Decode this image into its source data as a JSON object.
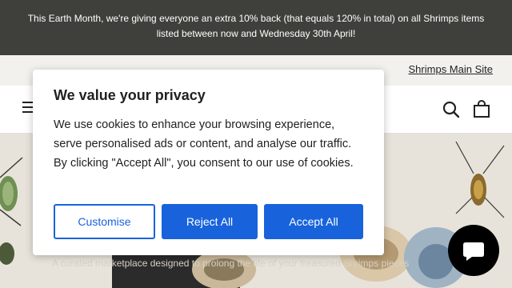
{
  "announcement": {
    "text": "This Earth Month, we're giving everyone an extra 10% back (that equals 120% in total) on all Shrimps items listed between now and Wednesday 30th April!"
  },
  "utility": {
    "main_site_link": "Shrimps Main Site"
  },
  "header": {
    "icons": [
      "menu-icon",
      "search-icon",
      "shopping-bag-icon"
    ]
  },
  "hero": {
    "tagline": "A curated marketplace designed to prolong the life of your treasured Shrimps pieces"
  },
  "cookie_banner": {
    "title": "We value your privacy",
    "body": "We use cookies to enhance your browsing experience, serve personalised ads or content, and analyse our traffic. By clicking \"Accept All\", you consent to our use of cookies.",
    "customise_label": "Customise",
    "reject_label": "Reject All",
    "accept_label": "Accept All"
  },
  "chat": {
    "icon": "chat-icon"
  },
  "colors": {
    "announcement_bg": "#3f403b",
    "utility_bg": "#f2f1ee",
    "accent_blue": "#1863dc"
  }
}
